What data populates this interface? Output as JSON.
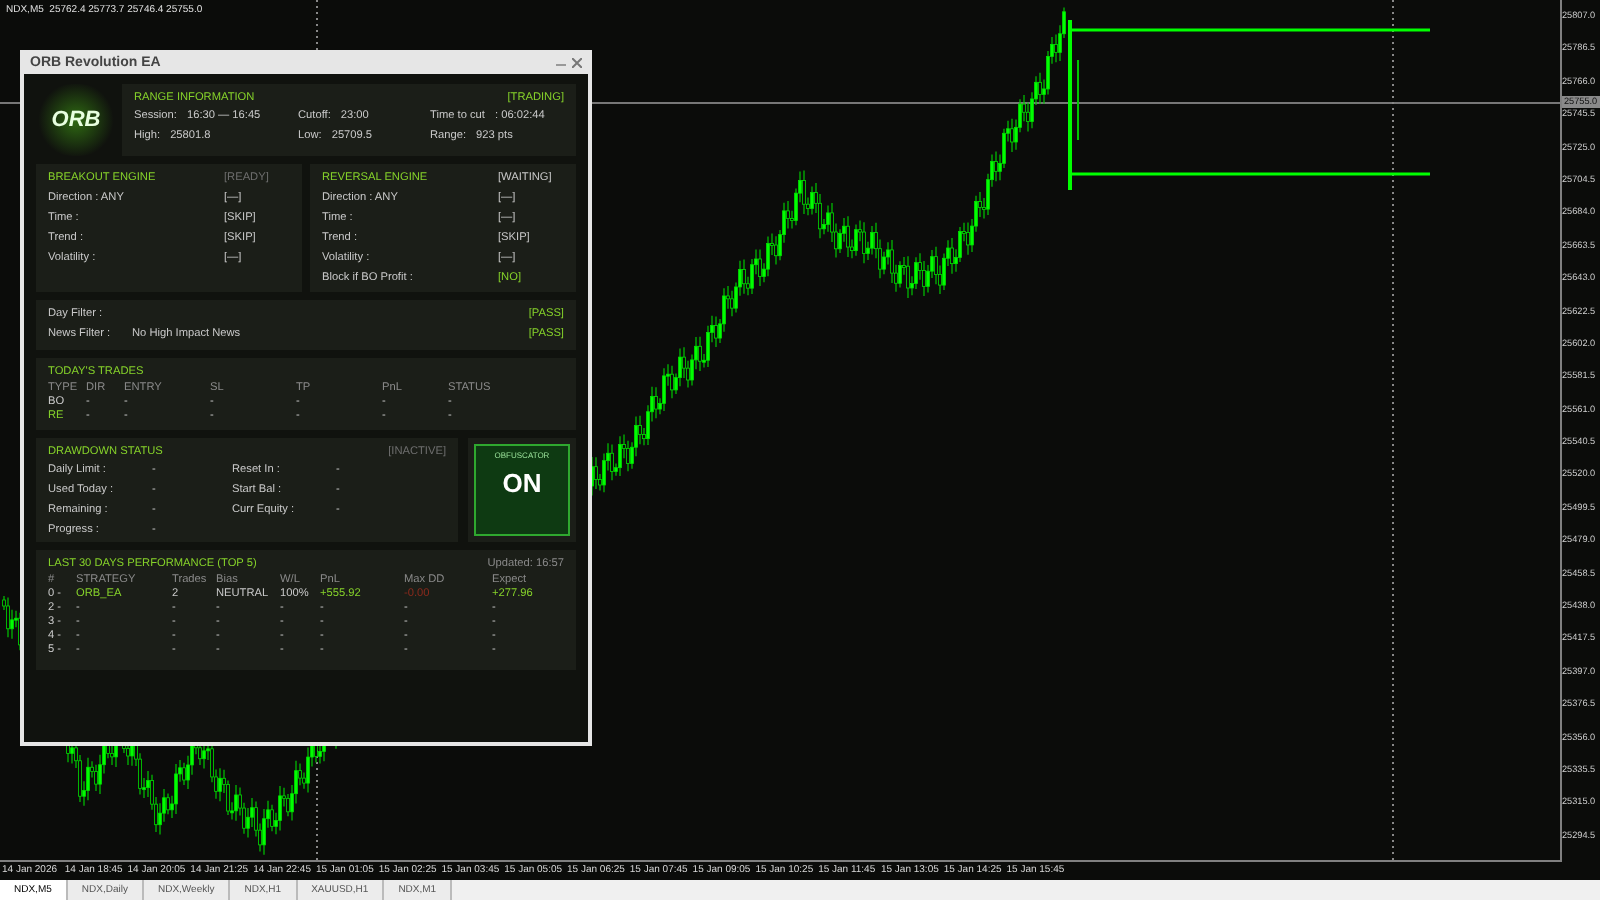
{
  "chart": {
    "header": "NDX,M5  25762.4 25773.7 25746.4 25755.0",
    "price_labels": [
      "25807.0",
      "25786.5",
      "25766.0",
      "25745.5",
      "25725.0",
      "25704.5",
      "25684.0",
      "25663.5",
      "25643.0",
      "25622.5",
      "25602.0",
      "25581.5",
      "25561.0",
      "25540.5",
      "25520.0",
      "25499.5",
      "25479.0",
      "25458.5",
      "25438.0",
      "25417.5",
      "25397.0",
      "25376.5",
      "25356.0",
      "25335.5",
      "25315.0",
      "25294.5"
    ],
    "current_price": "25755.0",
    "time_labels": [
      "14 Jan 2026",
      "14 Jan 18:45",
      "14 Jan 20:05",
      "14 Jan 21:25",
      "14 Jan 22:45",
      "15 Jan 01:05",
      "15 Jan 02:25",
      "15 Jan 03:45",
      "15 Jan 05:05",
      "15 Jan 06:25",
      "15 Jan 07:45",
      "15 Jan 09:05",
      "15 Jan 10:25",
      "15 Jan 11:45",
      "15 Jan 13:05",
      "15 Jan 14:25",
      "15 Jan 15:45"
    ]
  },
  "panel": {
    "title": "ORB Revolution EA",
    "logo_text": "ORB",
    "range": {
      "heading": "RANGE INFORMATION",
      "status": "[TRADING]",
      "fields": [
        {
          "label": "Session:",
          "value": "16:30 — 16:45"
        },
        {
          "label": "Cutoff:",
          "value": "23:00"
        },
        {
          "label": "Time to cut",
          "value": ": 06:02:44"
        },
        {
          "label": "High:",
          "value": "25801.8"
        },
        {
          "label": "Low:",
          "value": "25709.5"
        },
        {
          "label": "Range:",
          "value": "923 pts"
        }
      ]
    },
    "engines": [
      {
        "title": "BREAKOUT ENGINE",
        "status": "[READY]",
        "dim": true,
        "rows": [
          {
            "label": "Direction : ANY",
            "value": "[—]",
            "highlight": false
          },
          {
            "label": "Time :",
            "value": "[SKIP]",
            "highlight": false
          },
          {
            "label": "Trend :",
            "value": "[SKIP]",
            "highlight": false
          },
          {
            "label": "Volatility :",
            "value": "[—]",
            "highlight": false
          }
        ]
      },
      {
        "title": "REVERSAL ENGINE",
        "status": "[WAITING]",
        "dim": false,
        "rows": [
          {
            "label": "Direction : ANY",
            "value": "[—]",
            "highlight": false
          },
          {
            "label": "Time :",
            "value": "[—]",
            "highlight": false
          },
          {
            "label": "Trend :",
            "value": "[SKIP]",
            "highlight": false
          },
          {
            "label": "Volatility :",
            "value": "[—]",
            "highlight": false
          },
          {
            "label": "Block if BO Profit :",
            "value": "[NO]",
            "highlight": true
          }
        ]
      }
    ],
    "filters": [
      {
        "label": "Day Filter :",
        "result": "[PASS]"
      },
      {
        "label": "News Filter :",
        "detail": "No High Impact News",
        "result": "[PASS]"
      }
    ],
    "trades": {
      "heading": "TODAY'S TRADES",
      "columns": [
        "TYPE",
        "DIR",
        "ENTRY",
        "SL",
        "TP",
        "PnL",
        "STATUS"
      ],
      "rows": [
        {
          "highlight": false,
          "cells": [
            "BO",
            "-",
            "-",
            "-",
            "-",
            "-",
            "-"
          ]
        },
        {
          "highlight": true,
          "cells": [
            "RE",
            "-",
            "-",
            "-",
            "-",
            "-",
            "-"
          ]
        }
      ]
    },
    "drawdown": {
      "heading": "DRAWDOWN STATUS",
      "status": "[INACTIVE]",
      "fields": [
        {
          "label": "Daily Limit :",
          "value": "-"
        },
        {
          "label": "Reset In :",
          "value": "-"
        },
        {
          "label": "Used Today :",
          "value": "-"
        },
        {
          "label": "Start Bal :",
          "value": "-"
        },
        {
          "label": "Remaining :",
          "value": "-"
        },
        {
          "label": "Curr Equity :",
          "value": "-"
        },
        {
          "label": "Progress :",
          "value": "-"
        }
      ]
    },
    "obfuscator": {
      "label": "OBFUSCATOR",
      "state": "ON",
      "on": true
    },
    "performance": {
      "heading": "LAST 30 DAYS PERFORMANCE (TOP 5)",
      "updated": "Updated: 16:57",
      "columns": [
        "#",
        "STRATEGY",
        "Trades",
        "Bias",
        "W/L",
        "PnL",
        "Max DD",
        "Expect"
      ],
      "rows": [
        {
          "cells": [
            {
              "text": "0 -"
            },
            {
              "text": "ORB_EA",
              "color": "#86d32a"
            },
            {
              "text": "2"
            },
            {
              "text": "NEUTRAL"
            },
            {
              "text": "100%"
            },
            {
              "text": "+555.92",
              "color": "#86d32a"
            },
            {
              "text": "-0.00",
              "color": "#8a2a1c"
            },
            {
              "text": "+277.96",
              "color": "#86d32a"
            }
          ]
        },
        {
          "cells": [
            {
              "text": "2 -"
            },
            {
              "text": "-"
            },
            {
              "text": "-"
            },
            {
              "text": "-"
            },
            {
              "text": "-"
            },
            {
              "text": "-"
            },
            {
              "text": "-"
            },
            {
              "text": "-"
            }
          ]
        },
        {
          "cells": [
            {
              "text": "3 -"
            },
            {
              "text": "-"
            },
            {
              "text": "-"
            },
            {
              "text": "-"
            },
            {
              "text": "-"
            },
            {
              "text": "-"
            },
            {
              "text": "-"
            },
            {
              "text": "-"
            }
          ]
        },
        {
          "cells": [
            {
              "text": "4 -"
            },
            {
              "text": "-"
            },
            {
              "text": "-"
            },
            {
              "text": "-"
            },
            {
              "text": "-"
            },
            {
              "text": "-"
            },
            {
              "text": "-"
            },
            {
              "text": "-"
            }
          ]
        },
        {
          "cells": [
            {
              "text": "5 -"
            },
            {
              "text": "-"
            },
            {
              "text": "-"
            },
            {
              "text": "-"
            },
            {
              "text": "-"
            },
            {
              "text": "-"
            },
            {
              "text": "-"
            },
            {
              "text": "-"
            }
          ]
        }
      ]
    }
  },
  "tabs": [
    {
      "label": "NDX,M5",
      "selected": true
    },
    {
      "label": "NDX,Daily",
      "selected": false
    },
    {
      "label": "NDX,Weekly",
      "selected": false
    },
    {
      "label": "NDX,H1",
      "selected": false
    },
    {
      "label": "XAUUSD,H1",
      "selected": false
    },
    {
      "label": "NDX,M1",
      "selected": false
    }
  ]
}
